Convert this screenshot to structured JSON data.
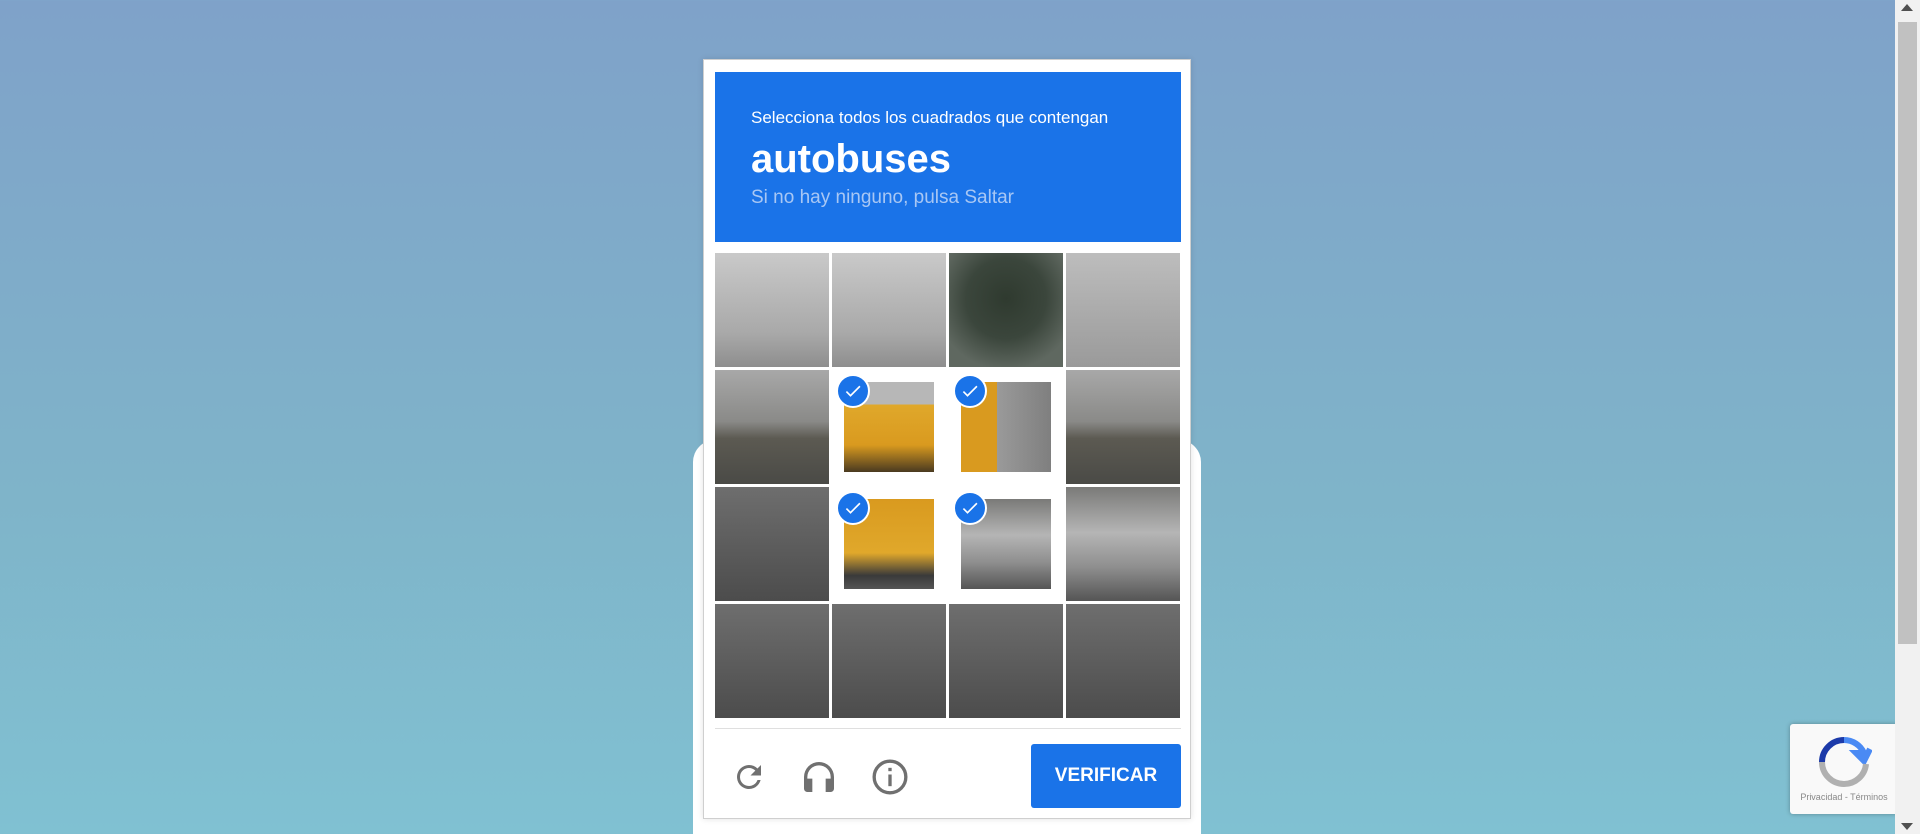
{
  "captcha": {
    "instruction": "Selecciona todos los cuadrados que contengan",
    "target": "autobuses",
    "hint": "Si no hay ninguno, pulsa Saltar",
    "verify_label": "VERIFICAR",
    "tiles": [
      {
        "selected": false,
        "scene": "sky"
      },
      {
        "selected": false,
        "scene": "sky"
      },
      {
        "selected": false,
        "scene": "tree"
      },
      {
        "selected": false,
        "scene": "sky-dark"
      },
      {
        "selected": false,
        "scene": "field"
      },
      {
        "selected": true,
        "scene": "bus-top"
      },
      {
        "selected": true,
        "scene": "bus-side"
      },
      {
        "selected": false,
        "scene": "field"
      },
      {
        "selected": false,
        "scene": "road"
      },
      {
        "selected": true,
        "scene": "bus-bot"
      },
      {
        "selected": true,
        "scene": "water"
      },
      {
        "selected": false,
        "scene": "water"
      },
      {
        "selected": false,
        "scene": "road"
      },
      {
        "selected": false,
        "scene": "road"
      },
      {
        "selected": false,
        "scene": "road"
      },
      {
        "selected": false,
        "scene": "road"
      }
    ],
    "icons": {
      "reload": "reload-icon",
      "audio": "headphones-icon",
      "info": "info-icon",
      "check": "check-icon"
    },
    "accent_color": "#1a73e8"
  },
  "badge": {
    "links": "Privacidad - Términos"
  }
}
